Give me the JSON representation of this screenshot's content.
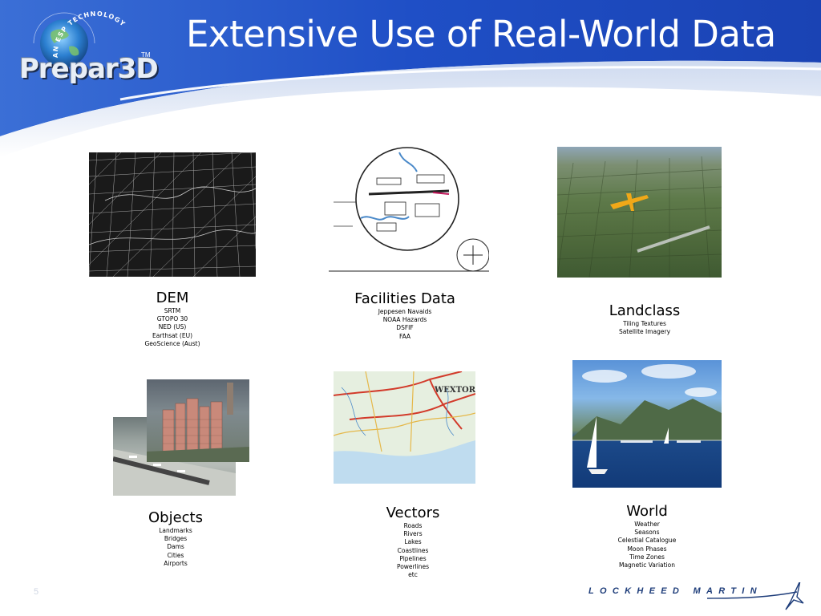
{
  "slide": {
    "title": "Extensive Use of Real-World Data",
    "page_number": "5"
  },
  "logo": {
    "tagline": "AN ESP TECHNOLOGY",
    "product": "Prepar3D",
    "trademark": "TM"
  },
  "footer": {
    "company": "LOCKHEED MARTIN"
  },
  "items": {
    "dem": {
      "heading": "DEM",
      "lines": [
        "SRTM",
        "GTOPO 30",
        "NED (US)",
        "Earthsat (EU)",
        "GeoScience (Aust)"
      ]
    },
    "facilities": {
      "heading": "Facilities Data",
      "lines": [
        "Jeppesen Navaids",
        "NOAA Hazards",
        "DSFIF",
        "FAA"
      ]
    },
    "landclass": {
      "heading": "Landclass",
      "lines": [
        "Tiling Textures",
        "Satellite Imagery"
      ]
    },
    "objects": {
      "heading": "Objects",
      "lines": [
        "Landmarks",
        "Bridges",
        "Dams",
        "Cities",
        "Airports"
      ]
    },
    "vectors": {
      "heading": "Vectors",
      "lines": [
        "Roads",
        "Rivers",
        "Lakes",
        "Coastlines",
        "Pipelines",
        "Powerlines",
        "etc"
      ]
    },
    "world": {
      "heading": "World",
      "lines": [
        "Weather",
        "Seasons",
        "Celestial Catalogue",
        "Moon Phases",
        "Time Zones",
        "Magnetic Variation"
      ]
    }
  },
  "map_label": "WEXTOR",
  "colors": {
    "header_blue": "#1f4fc6",
    "header_dark": "#16379a",
    "logo_navy": "#1e3d7a",
    "footer_text": "#1e3d7a"
  }
}
